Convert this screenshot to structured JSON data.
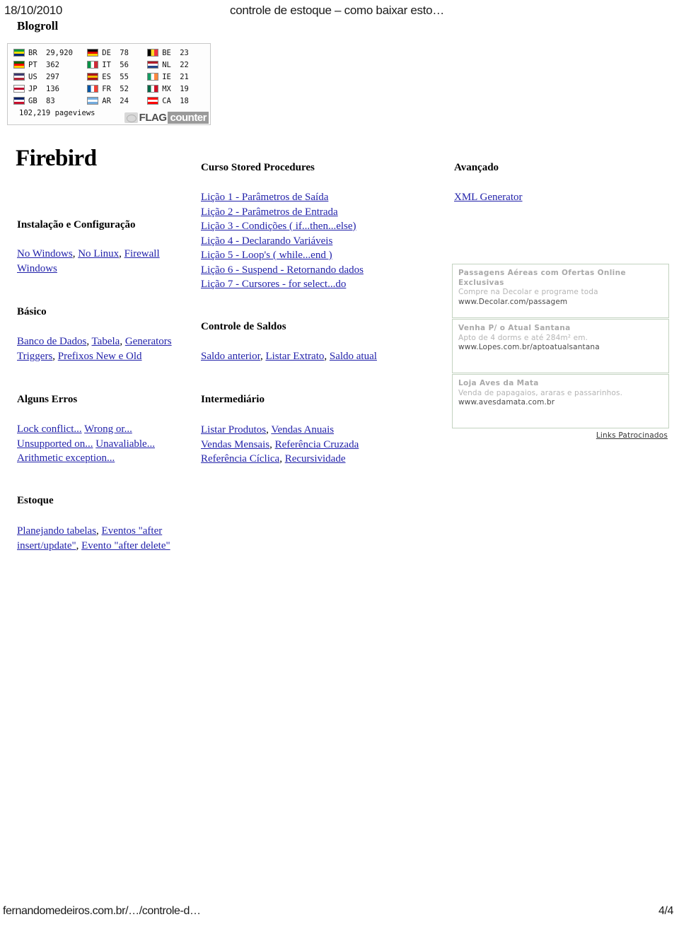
{
  "header": {
    "date": "18/10/2010",
    "page_title": "controle de estoque – como baixar esto…",
    "blogroll_label": "Blogroll"
  },
  "flag_counter": {
    "columns": [
      [
        {
          "code": "BR",
          "count": "29,920",
          "colors": [
            "#009b3a",
            "#ffdf00",
            "#002776"
          ]
        },
        {
          "code": "PT",
          "count": "362",
          "colors": [
            "#006600",
            "#ff0000",
            "#ffcc00"
          ]
        },
        {
          "code": "US",
          "count": "297",
          "colors": [
            "#3c3b6e",
            "#ffffff",
            "#b22234"
          ]
        },
        {
          "code": "JP",
          "count": "136",
          "colors": [
            "#ffffff",
            "#bc002d",
            "#ffffff"
          ]
        },
        {
          "code": "GB",
          "count": "83",
          "colors": [
            "#012169",
            "#ffffff",
            "#c8102e"
          ]
        }
      ],
      [
        {
          "code": "DE",
          "count": "78",
          "colors": [
            "#000000",
            "#dd0000",
            "#ffce00"
          ]
        },
        {
          "code": "IT",
          "count": "56",
          "colors": [
            "#009246",
            "#ffffff",
            "#ce2b37"
          ]
        },
        {
          "code": "ES",
          "count": "55",
          "colors": [
            "#aa151b",
            "#f1bf00",
            "#aa151b"
          ]
        },
        {
          "code": "FR",
          "count": "52",
          "colors": [
            "#0055a4",
            "#ffffff",
            "#ef4135"
          ]
        },
        {
          "code": "AR",
          "count": "24",
          "colors": [
            "#74acdf",
            "#ffffff",
            "#74acdf"
          ]
        }
      ],
      [
        {
          "code": "BE",
          "count": "23",
          "colors": [
            "#000000",
            "#fdda24",
            "#ef3340"
          ]
        },
        {
          "code": "NL",
          "count": "22",
          "colors": [
            "#ae1c28",
            "#ffffff",
            "#21468b"
          ]
        },
        {
          "code": "IE",
          "count": "21",
          "colors": [
            "#169b62",
            "#ffffff",
            "#ff883e"
          ]
        },
        {
          "code": "MX",
          "count": "19",
          "colors": [
            "#006847",
            "#ffffff",
            "#ce1126"
          ]
        },
        {
          "code": "CA",
          "count": "18",
          "colors": [
            "#ff0000",
            "#ffffff",
            "#ff0000"
          ]
        }
      ]
    ],
    "pageviews": "102,219 pageviews",
    "brand_flag": "FLAG",
    "brand_counter": "counter"
  },
  "left_column": {
    "title": "Firebird",
    "sections": [
      {
        "heading": "Instalação e Configuração",
        "lines": [
          [
            {
              "text": "No Windows",
              "link": true
            },
            {
              "text": ", ",
              "link": false
            },
            {
              "text": "No Linux",
              "link": true
            },
            {
              "text": ", ",
              "link": false
            },
            {
              "text": "Firewall",
              "link": true
            }
          ],
          [
            {
              "text": "Windows",
              "link": true
            }
          ]
        ]
      },
      {
        "heading": "Básico",
        "lines": [
          [
            {
              "text": "Banco de Dados",
              "link": true
            },
            {
              "text": ", ",
              "link": false
            },
            {
              "text": "Tabela",
              "link": true
            },
            {
              "text": ", ",
              "link": false
            },
            {
              "text": "Generators",
              "link": true
            }
          ],
          [
            {
              "text": "Triggers",
              "link": true
            },
            {
              "text": ", ",
              "link": false
            },
            {
              "text": "Prefixos New e Old",
              "link": true
            }
          ]
        ]
      },
      {
        "heading": "Alguns Erros",
        "lines": [
          [
            {
              "text": "Lock conflict...",
              "link": true
            },
            {
              "text": " ",
              "link": false
            },
            {
              "text": "Wrong or...",
              "link": true
            }
          ],
          [
            {
              "text": "Unsupported on...",
              "link": true
            },
            {
              "text": " ",
              "link": false
            },
            {
              "text": "Unavaliable...",
              "link": true
            }
          ],
          [
            {
              "text": "Arithmetic exception...",
              "link": true
            }
          ]
        ]
      },
      {
        "heading": "Estoque",
        "lines": [
          [
            {
              "text": "Planejando tabelas",
              "link": true
            },
            {
              "text": ", ",
              "link": false
            },
            {
              "text": "Eventos \"after",
              "link": true
            }
          ],
          [
            {
              "text": "insert/update\"",
              "link": true
            },
            {
              "text": ", ",
              "link": false
            },
            {
              "text": "Evento \"after delete\"",
              "link": true
            }
          ]
        ]
      }
    ]
  },
  "middle_column": {
    "sections": [
      {
        "heading": "Curso Stored Procedures",
        "lines": [
          [
            {
              "text": "Lição 1 - Parâmetros de Saída",
              "link": true
            }
          ],
          [
            {
              "text": "Lição 2 - Parâmetros de Entrada",
              "link": true
            }
          ],
          [
            {
              "text": "Lição 3 - Condições ( if...then...else)",
              "link": true
            }
          ],
          [
            {
              "text": "Lição 4 - Declarando Variáveis",
              "link": true
            }
          ],
          [
            {
              "text": "Lição 5 - Loop's ( while...end )",
              "link": true
            }
          ],
          [
            {
              "text": "Lição 6 - Suspend - Retornando dados",
              "link": true
            }
          ],
          [
            {
              "text": "Lição 7 - Cursores - for select...do",
              "link": true
            }
          ]
        ]
      },
      {
        "heading": "Controle de Saldos",
        "lines": [
          [
            {
              "text": "Saldo anterior",
              "link": true
            },
            {
              "text": ", ",
              "link": false
            },
            {
              "text": "Listar Extrato",
              "link": true
            },
            {
              "text": ", ",
              "link": false
            },
            {
              "text": "Saldo atual",
              "link": true
            }
          ]
        ]
      },
      {
        "heading": "Intermediário",
        "lines": [
          [
            {
              "text": "Listar Produtos",
              "link": true
            },
            {
              "text": ", ",
              "link": false
            },
            {
              "text": "Vendas Anuais",
              "link": true
            }
          ],
          [
            {
              "text": "Vendas Mensais",
              "link": true
            },
            {
              "text": ", ",
              "link": false
            },
            {
              "text": "Referência Cruzada",
              "link": true
            }
          ],
          [
            {
              "text": "Referência Cíclica",
              "link": true
            },
            {
              "text": ", ",
              "link": false
            },
            {
              "text": "Recursividade",
              "link": true
            }
          ]
        ]
      }
    ]
  },
  "right_column": {
    "heading": "Avançado",
    "link": "XML Generator",
    "ads": [
      {
        "title": "Passagens Aéreas com Ofertas Online Exclusivas",
        "description": "Compre na Decolar e programe toda",
        "url": "www.Decolar.com/passagem"
      },
      {
        "title": "Venha P/ o Atual Santana",
        "description": "Apto de 4 dorms e até 284m² em.",
        "url": "www.Lopes.com.br/aptoatualsantana"
      },
      {
        "title": "Loja Aves da Mata",
        "description": "Venda de papagaios, araras e passarinhos.",
        "url": "www.avesdamata.com.br"
      }
    ],
    "sponsored_label": "Links Patrocinados"
  },
  "footer": {
    "url": "fernandomedeiros.com.br/…/controle-d…",
    "page_number": "4/4"
  },
  "colors": {
    "link": "#2222aa",
    "ad_border": "#c3d3c0",
    "ad_title": "#a9a9a9",
    "ad_desc": "#b4b4b4",
    "ad_url": "#4a4a4a"
  }
}
